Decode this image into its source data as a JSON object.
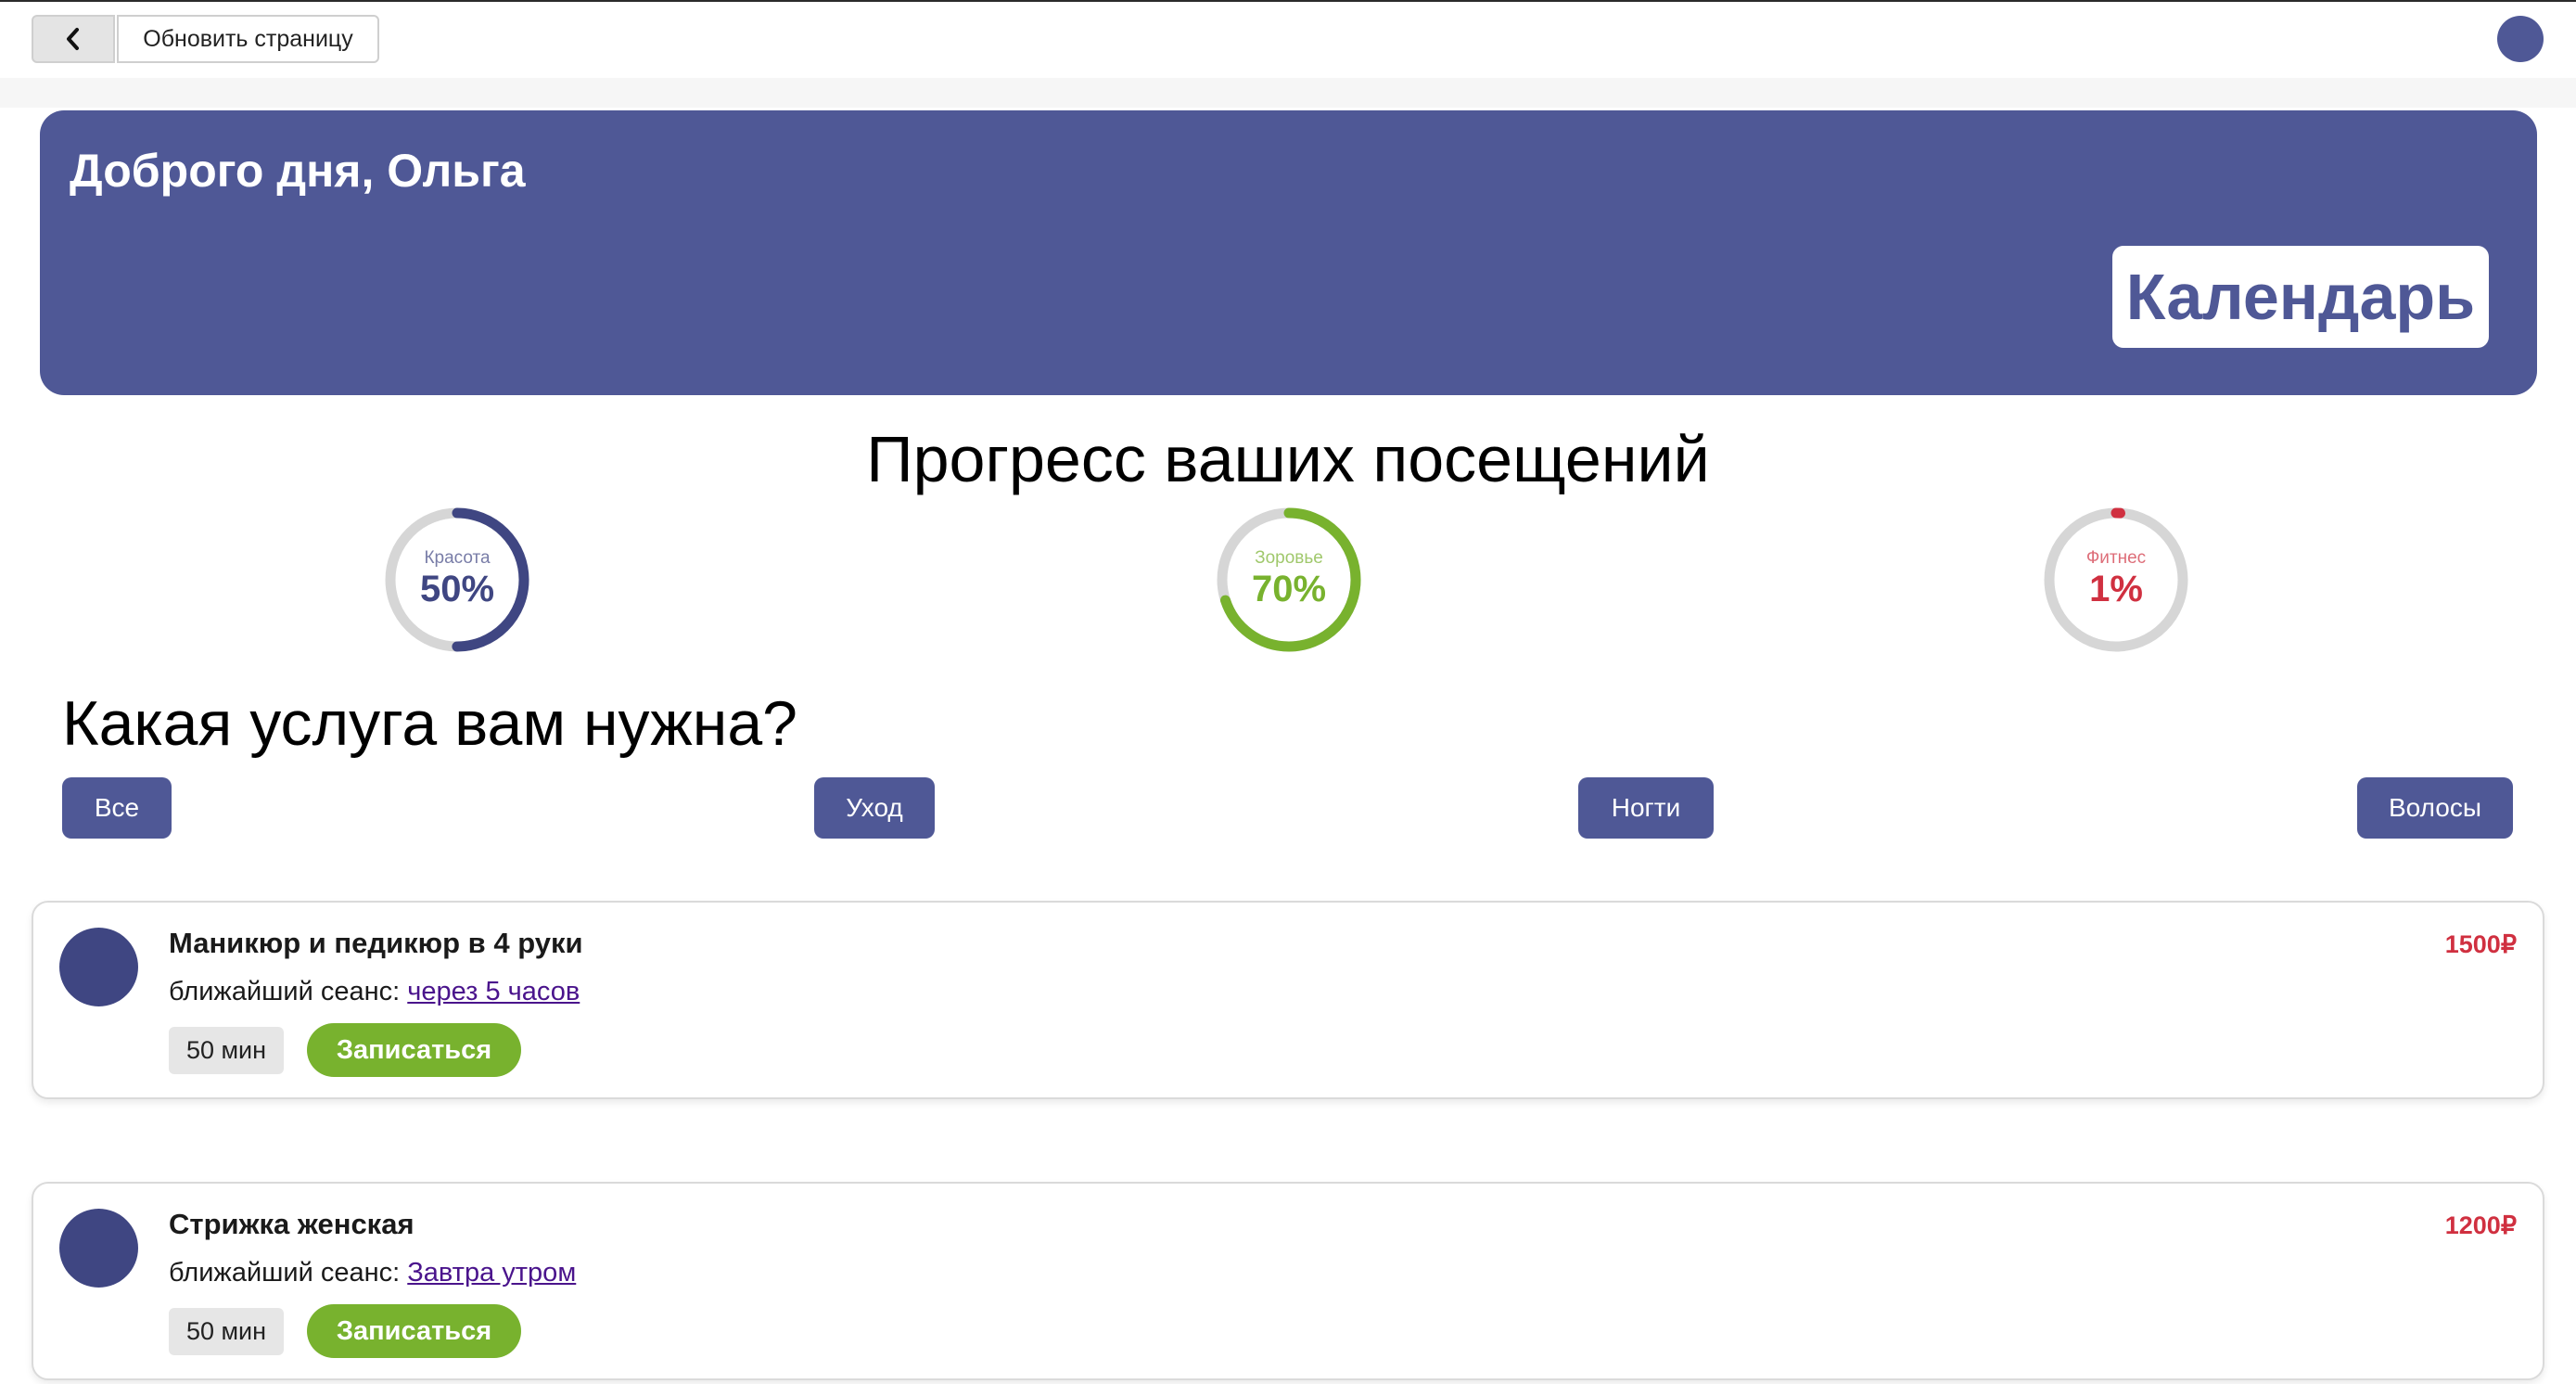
{
  "toolbar": {
    "back_icon": "chevron-left-icon",
    "refresh_label": "Обновить страницу"
  },
  "banner": {
    "greeting": "Доброго дня, Ольга",
    "calendar_label": "Календарь"
  },
  "progress": {
    "title": "Прогресс ваших посещений",
    "items": [
      {
        "label": "Красота",
        "value_text": "50%",
        "value": 50,
        "color": "#3f4682"
      },
      {
        "label": "Зоровье",
        "value_text": "70%",
        "value": 70,
        "color": "#78b22e"
      },
      {
        "label": "Фитнес",
        "value_text": "1%",
        "value": 1,
        "color": "#d03040"
      }
    ]
  },
  "services": {
    "title": "Какая услуга вам нужна?",
    "filters": [
      "Все",
      "Уход",
      "Ногти",
      "Волосы"
    ]
  },
  "cards": [
    {
      "name": "Маникюр и педикюр в 4 руки",
      "next_prefix": "ближайший сеанс: ",
      "next_link": "через 5 часов",
      "duration": "50 мин",
      "book_label": "Записаться",
      "price": "1500₽"
    },
    {
      "name": "Стрижка женская",
      "next_prefix": "ближайший сеанс: ",
      "next_link": "Завтра утром",
      "duration": "50 мин",
      "book_label": "Записаться",
      "price": "1200₽"
    }
  ],
  "colors": {
    "primary": "#4f5896",
    "accent_green": "#78b22e",
    "price_red": "#d03040"
  }
}
